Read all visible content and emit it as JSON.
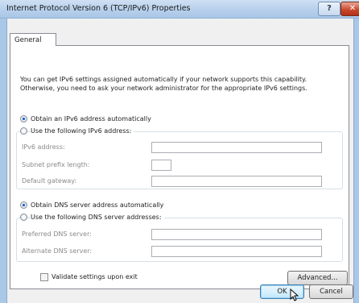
{
  "window": {
    "title": "Internet Protocol Version 6 (TCP/IPv6) Properties",
    "help_label": "?",
    "close_label": "✕"
  },
  "tabs": [
    {
      "label": "General",
      "selected": true
    }
  ],
  "intro_text": "You can get IPv6 settings assigned automatically if your network supports this capability. Otherwise, you need to ask your network administrator for the appropriate IPv6 settings.",
  "ip": {
    "auto_label": "Obtain an IPv6 address automatically",
    "auto_selected": true,
    "manual_label": "Use the following IPv6 address:",
    "manual_selected": false,
    "fields": [
      {
        "label": "IPv6 address:",
        "value": ""
      },
      {
        "label": "Subnet prefix length:",
        "value": ""
      },
      {
        "label": "Default gateway:",
        "value": ""
      }
    ]
  },
  "dns": {
    "auto_label": "Obtain DNS server address automatically",
    "auto_selected": true,
    "manual_label": "Use the following DNS server addresses:",
    "manual_selected": false,
    "fields": [
      {
        "label": "Preferred DNS server:",
        "value": ""
      },
      {
        "label": "Alternate DNS server:",
        "value": ""
      }
    ]
  },
  "validate": {
    "label": "Validate settings upon exit",
    "checked": false
  },
  "buttons": {
    "advanced": "Advanced...",
    "ok": "OK",
    "cancel": "Cancel"
  }
}
